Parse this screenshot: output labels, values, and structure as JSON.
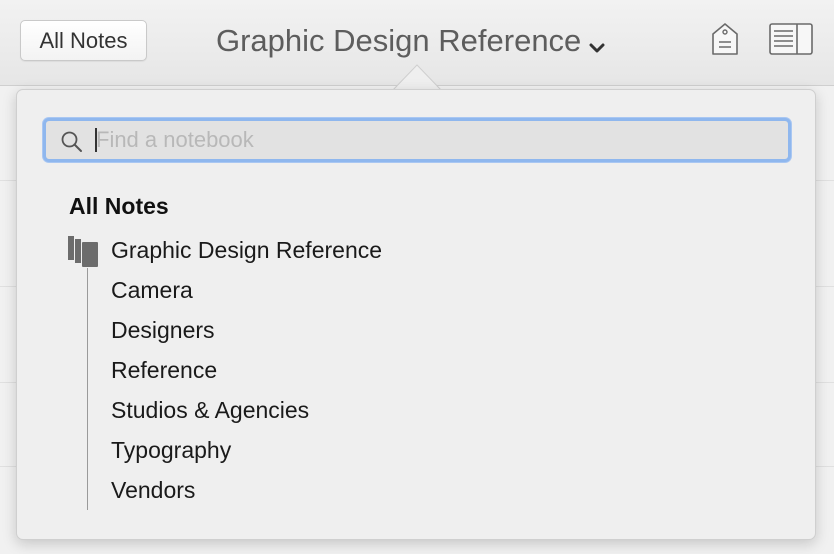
{
  "toolbar": {
    "all_notes_label": "All Notes",
    "title": "Graphic Design Reference"
  },
  "popover": {
    "search": {
      "placeholder": "Find a notebook",
      "value": ""
    },
    "section_header": "All Notes",
    "stack": {
      "label": "Graphic Design Reference",
      "notebooks": [
        "Camera",
        "Designers",
        "Reference",
        "Studios & Agencies",
        "Typography",
        "Vendors"
      ]
    }
  },
  "colors": {
    "focus_ring": "#8fb7ee",
    "popover_bg": "#efefef",
    "title_text": "#5d5d5d"
  },
  "icons": [
    "search-icon",
    "tag-icon",
    "sidebar-toggle-icon",
    "chevron-down-icon",
    "notebook-stack-icon"
  ]
}
